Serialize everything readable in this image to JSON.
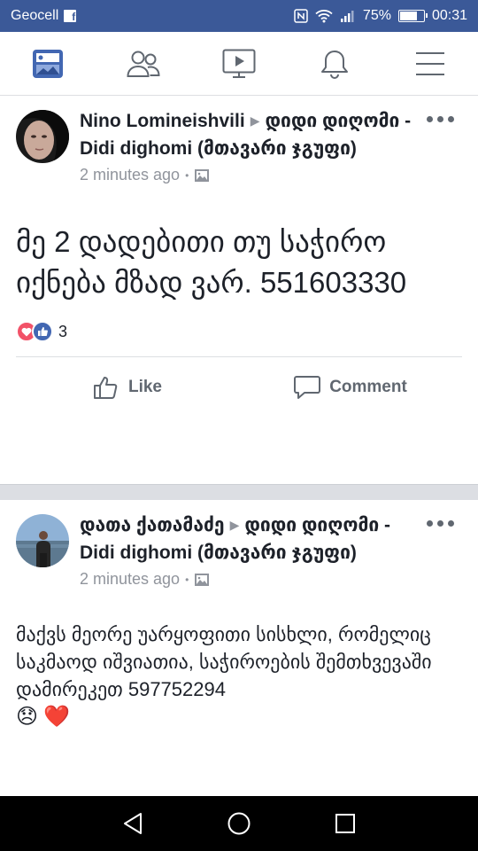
{
  "status_bar": {
    "carrier": "Geocell",
    "battery": "75%",
    "battery_level": 0.75,
    "time": "00:31"
  },
  "nav": {
    "items": [
      {
        "icon": "news-feed-icon",
        "active": true
      },
      {
        "icon": "friends-icon",
        "active": false
      },
      {
        "icon": "watch-icon",
        "active": false
      },
      {
        "icon": "notifications-icon",
        "active": false
      },
      {
        "icon": "menu-icon",
        "active": false
      }
    ],
    "active_color": "#4267b2",
    "inactive_color": "#606770"
  },
  "posts": [
    {
      "author": "Nino Lomineishvili",
      "group": "დიდი დიღომი - Didi dighomi (მთავარი ჯგუფი)",
      "time": "2 minutes ago",
      "body": "მე 2 დადებითი თუ საჭირო იქნება მზად ვარ. 551603330",
      "reaction_count": "3",
      "actions": {
        "like": "Like",
        "comment": "Comment"
      }
    },
    {
      "author": "დათა ქათამაძე",
      "group": "დიდი დიღომი - Didi dighomi (მთავარი ჯგუფი)",
      "time": "2 minutes ago",
      "body": "მაქვს მეორე უარყოფითი სისხლი, რომელიც საკმაოდ იშვიათია, საჭიროების შემთხვევაში დამირეკეთ 597752294",
      "emoji": [
        "😞",
        "❤️"
      ]
    }
  ]
}
